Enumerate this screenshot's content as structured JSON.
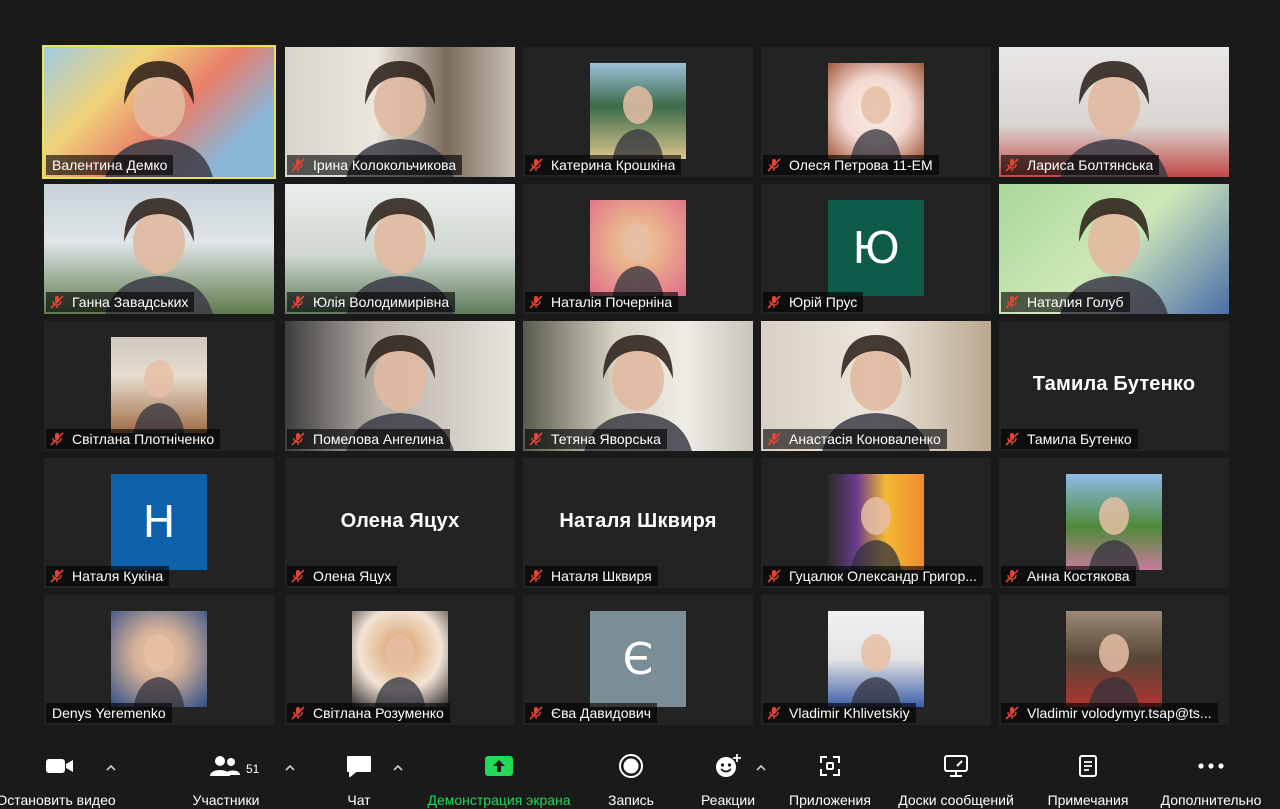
{
  "participants": [
    {
      "name": "Валентина Демко",
      "kind": "video",
      "active": true,
      "muted": false
    },
    {
      "name": "Ірина Колокольчикова",
      "kind": "video",
      "muted": true
    },
    {
      "name": "Катерина Крошкіна",
      "kind": "photo",
      "muted": true
    },
    {
      "name": "Олеся Петрова 11-ЕМ",
      "kind": "photo",
      "muted": true
    },
    {
      "name": "Лариса Болтянська",
      "kind": "video",
      "muted": true
    },
    {
      "name": "Ганна Завадських",
      "kind": "video",
      "muted": true
    },
    {
      "name": "Юлія Володимирівна",
      "kind": "video",
      "muted": true
    },
    {
      "name": "Наталія Почерніна",
      "kind": "photo",
      "muted": true
    },
    {
      "name": "Юрій Прус",
      "kind": "letter",
      "letter": "Ю",
      "letter_bg": "#0e5b49",
      "muted": true
    },
    {
      "name": "Наталия Голуб",
      "kind": "video",
      "muted": true
    },
    {
      "name": "Світлана Плотніченко",
      "kind": "photo",
      "muted": true
    },
    {
      "name": "Помелова Ангелина",
      "kind": "video",
      "muted": true
    },
    {
      "name": "Тетяна Яворська",
      "kind": "video",
      "muted": true
    },
    {
      "name": "Анастасія Коноваленко",
      "kind": "video",
      "muted": true
    },
    {
      "name": "Тамила Бутенко",
      "kind": "text",
      "display": "Тамила Бутенко",
      "muted": true
    },
    {
      "name": "Наталя Кукіна",
      "kind": "letter",
      "letter": "Н",
      "letter_bg": "#0e62ac",
      "muted": true
    },
    {
      "name": "Олена Яцух",
      "kind": "text",
      "display": "Олена Яцух",
      "muted": true
    },
    {
      "name": "Наталя Шквиря",
      "kind": "text",
      "display": "Наталя Шквиря",
      "muted": true
    },
    {
      "name": "Гуцалюк Олександр Григор...",
      "kind": "photo",
      "muted": true
    },
    {
      "name": "Анна Костякова",
      "kind": "photo",
      "muted": true
    },
    {
      "name": "Denys Yeremenko",
      "kind": "photo",
      "muted": false
    },
    {
      "name": "Світлана Розуменко",
      "kind": "photo",
      "muted": true
    },
    {
      "name": "Єва Давидович",
      "kind": "letter",
      "letter": "Є",
      "letter_bg": "#7b8d96",
      "muted": true
    },
    {
      "name": "Vladimir Khlivetskiy",
      "kind": "photo",
      "muted": true
    },
    {
      "name": "Vladimir volodymyr.tsap@ts...",
      "kind": "photo",
      "muted": true
    }
  ],
  "toolbar": {
    "stop_video": "Остановить видео",
    "participants": "Участники",
    "participants_count": "51",
    "chat": "Чат",
    "share_screen": "Демонстрация экрана",
    "record": "Запись",
    "reactions": "Реакции",
    "apps": "Приложения",
    "whiteboards": "Доски сообщений",
    "notes": "Примечания",
    "more": "Дополнительно"
  },
  "colors": {
    "active_border": "#e4e35a",
    "share_green": "#23d959",
    "muted_red": "#e0453a",
    "background": "#1a1a1a",
    "tile": "#232323"
  }
}
